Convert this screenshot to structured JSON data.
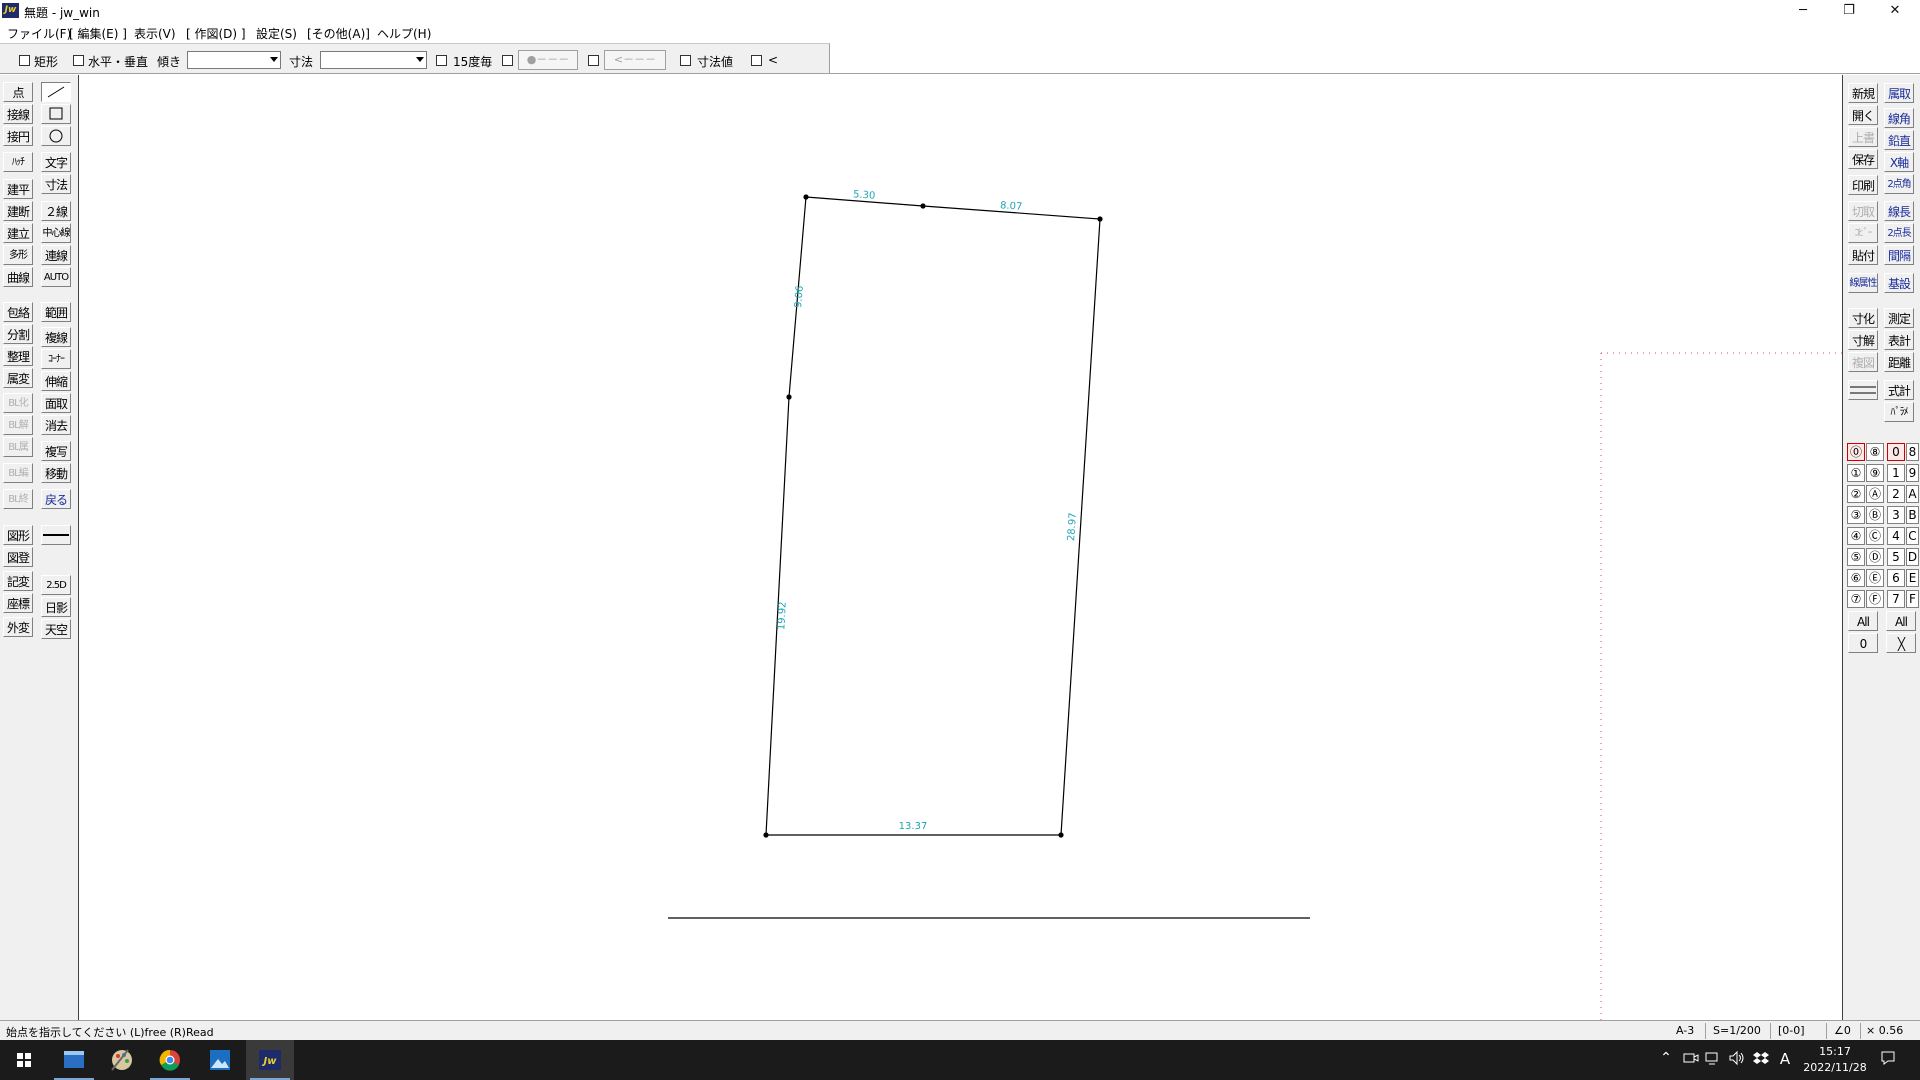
{
  "window": {
    "title": "無題 - jw_win",
    "icon_text": "Jw",
    "minimize": "─",
    "restore": "❐",
    "close": "✕"
  },
  "menu": [
    "ファイル(F)",
    "[ 編集(E) ]",
    "表示(V)",
    "[ 作図(D) ]",
    "設定(S)",
    "[その他(A)]",
    "ヘルプ(H)"
  ],
  "options": {
    "rect": "矩形",
    "horizontal_vertical": "水平・垂直",
    "tilt": "傾き",
    "dimension": "寸法",
    "deg15": "15度毎",
    "dim_value": "寸法値",
    "arrow": "<",
    "btn1": "●－－－",
    "btn2": "<－－－"
  },
  "left_col1": [
    "点",
    "接線",
    "接円",
    "ﾊｯﾁ",
    "建平",
    "建断",
    "建立",
    "多形",
    "曲線",
    "包絡",
    "分割",
    "整理",
    "属変",
    "BL化",
    "BL解",
    "BL属",
    "BL編",
    "BL終",
    "図形",
    "図登",
    "記変",
    "座標",
    "外変"
  ],
  "left_col2": [
    "／",
    "□",
    "○",
    "文字",
    "寸法",
    "２線",
    "中心線",
    "連線",
    "AUTO",
    "範囲",
    "複線",
    "ｺｰﾅｰ",
    "伸縮",
    "面取",
    "消去",
    "複写",
    "移動",
    "戻る",
    "2.5D",
    "日影",
    "天空"
  ],
  "right_col1": [
    "新規",
    "開く",
    "上書",
    "保存",
    "印刷",
    "切取",
    "ｺﾋﾟｰ",
    "貼付",
    "線属性",
    "寸化",
    "寸解",
    "複図"
  ],
  "right_col2": [
    "属取",
    "線角",
    "鉛直",
    "X軸",
    "2点角",
    "線長",
    "2点長",
    "間隔",
    "基設",
    "測定",
    "表計",
    "距離",
    "式計",
    "ﾊﾟﾗﾒ"
  ],
  "layers": {
    "col1": [
      "⓪",
      "①",
      "②",
      "③",
      "④",
      "⑤",
      "⑥",
      "⑦"
    ],
    "col2": [
      "⑧",
      "⑨",
      "Ⓐ",
      "Ⓑ",
      "Ⓒ",
      "Ⓓ",
      "Ⓔ",
      "Ⓕ"
    ],
    "col3": [
      "0",
      "1",
      "2",
      "3",
      "4",
      "5",
      "6",
      "7"
    ],
    "col4": [
      "8",
      "9",
      "A",
      "B",
      "C",
      "D",
      "E",
      "F"
    ],
    "all1": "All",
    "all2": "All",
    "zero": "0",
    "x_btn": "╳"
  },
  "drawing": {
    "dims": {
      "top_left": "5.30",
      "top_right": "8.07",
      "left_upper": "9.06",
      "left_lower": "19.92",
      "right": "28.97",
      "bottom": "13.37"
    },
    "colors": {
      "line": "#000000",
      "dim_text": "#1fa5b8",
      "paper_border": "#e0407a"
    }
  },
  "status": {
    "message": "始点を指示してください (L)free (R)Read",
    "paper": "A-3",
    "scale": "S=1/200",
    "layer": "[0-0]",
    "angle": "∠0",
    "ratio": "× 0.56"
  },
  "taskbar": {
    "time": "15:17",
    "date": "2022/11/28",
    "ime": "A"
  }
}
